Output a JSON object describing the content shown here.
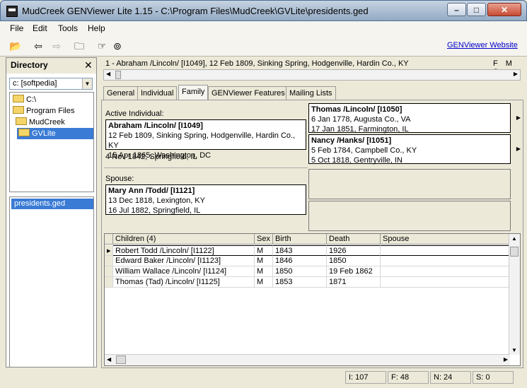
{
  "window": {
    "title": "MudCreek GENViewer Lite 1.15 - C:\\Program Files\\MudCreek\\GVLite\\presidents.ged"
  },
  "menu": [
    "File",
    "Edit",
    "Tools",
    "Help"
  ],
  "toolbar": {
    "link": "GENViewer Website",
    "icons": [
      "open-folder-icon",
      "back-arrow-icon",
      "forward-arrow-icon",
      "folder-icon",
      "pointer-icon",
      "binoculars-icon"
    ]
  },
  "directory": {
    "title": "Directory",
    "drive": "c: [softpedia]",
    "tree": [
      "C:\\",
      "Program Files",
      "MudCreek",
      "GVLite"
    ],
    "files": [
      "presidents.ged"
    ]
  },
  "individual": {
    "line": "1 - Abraham /Lincoln/ [I1049], 12 Feb 1809, Sinking Spring, Hodgenville, Hardin Co., KY",
    "fms": "F M S"
  },
  "tabs": [
    "General",
    "Individual",
    "Family",
    "GENViewer Features",
    "Mailing Lists"
  ],
  "family": {
    "active_label": "Active Individual:",
    "active": {
      "name": "Abraham /Lincoln/ [I1049]",
      "birth": "12 Feb 1809, Sinking Spring, Hodgenville, Hardin Co., KY",
      "death": "15 Apr 1865, Washington, DC"
    },
    "marriage": "4 Nov 1842, Springfield, IL",
    "father": {
      "name": "Thomas /Lincoln/ [I1050]",
      "birth": "6 Jan 1778, Augusta Co., VA",
      "death": "17 Jan 1851, Farmington, IL"
    },
    "mother": {
      "name": "Nancy /Hanks/ [I1051]",
      "birth": "5 Feb 1784, Campbell Co., KY",
      "death": "5 Oct 1818, Gentryville, IN"
    },
    "spouse_label": "Spouse:",
    "spouse": {
      "name": "Mary Ann /Todd/ [I1121]",
      "birth": "13 Dec 1818, Lexington, KY",
      "death": "16 Jul 1882, Springfield, IL"
    }
  },
  "children": {
    "headers": [
      "Children (4)",
      "Sex",
      "Birth",
      "Death",
      "Spouse"
    ],
    "rows": [
      [
        "Robert Todd /Lincoln/ [I1122]",
        "M",
        "1843",
        "1926",
        ""
      ],
      [
        "Edward Baker /Lincoln/ [I1123]",
        "M",
        "1846",
        "1850",
        ""
      ],
      [
        "William Wallace /Lincoln/ [I1124]",
        "M",
        "1850",
        "19 Feb 1862",
        ""
      ],
      [
        "Thomas (Tad) /Lincoln/ [I1125]",
        "M",
        "1853",
        "1871",
        ""
      ]
    ]
  },
  "status": {
    "i": "I: 107",
    "f": "F: 48",
    "n": "N: 24",
    "s": "S: 0"
  }
}
